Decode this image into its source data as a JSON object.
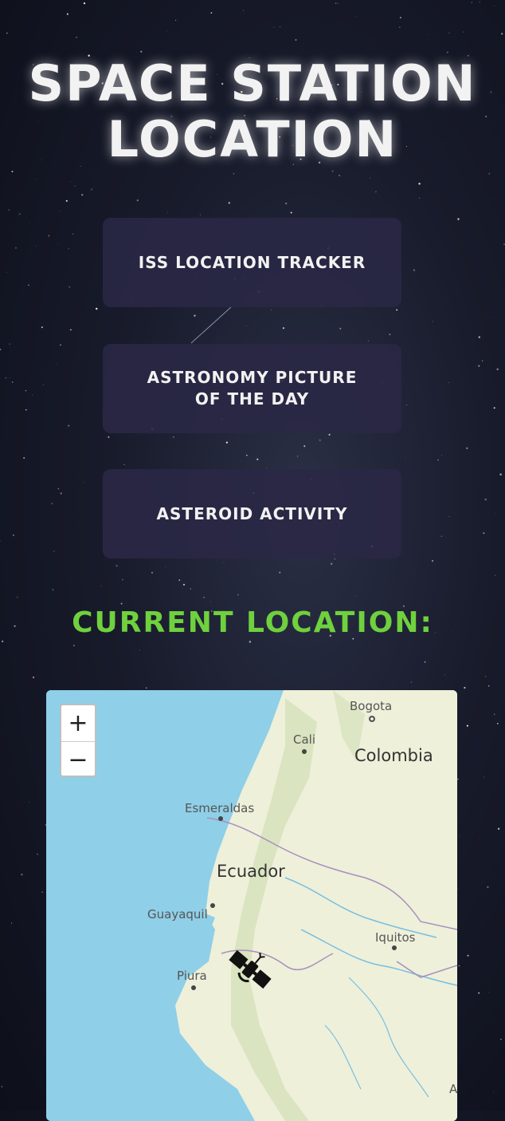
{
  "title": "SPACE STATION LOCATION",
  "nav": {
    "iss": "ISS LOCATION TRACKER",
    "apod": "ASTRONOMY PICTURE OF THE DAY",
    "asteroid": "ASTEROID ACTIVITY"
  },
  "current_label": "CURRENT LOCATION:",
  "map": {
    "zoom_in": "+",
    "zoom_out": "−",
    "labels": {
      "bogota": "Bogota",
      "cali": "Cali",
      "colombia": "Colombia",
      "esmeraldas": "Esmeraldas",
      "ecuador": "Ecuador",
      "guayaquil": "Guayaquil",
      "iquitos": "Iquitos",
      "piura": "Piura",
      "edge": "A"
    },
    "marker_icon": "satellite-icon"
  },
  "colors": {
    "accent": "#6fd13d",
    "button_bg": "#2a2846",
    "ocean": "#8fcfe8",
    "land": "#eef0da"
  }
}
